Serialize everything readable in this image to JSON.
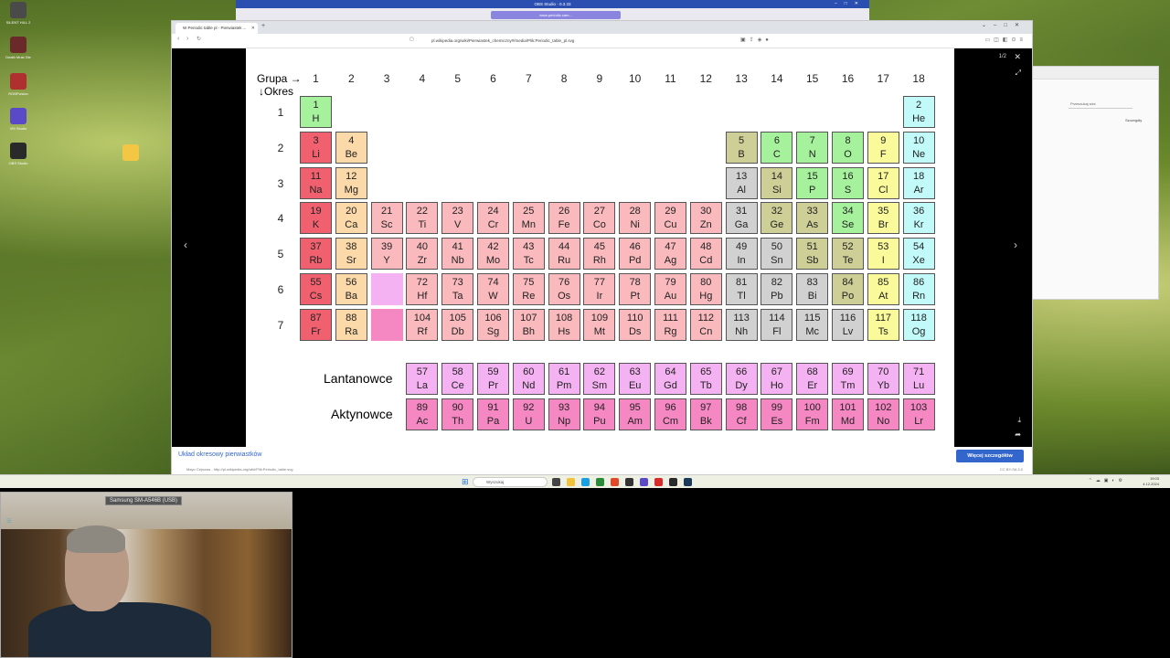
{
  "obs": {
    "title": "OBS Studio - 0.3.33",
    "active_tab": "www.periodic.cam..."
  },
  "browser": {
    "tab_title": "W Periodic table pl - Pierwiastek ...",
    "url": "pl.wikipedia.org/wiki/Pierwiastek_chemiczny#/media/Plik:Periodic_table_pl.svg",
    "viewer_counter": "1/2",
    "caption": "Układ okresowy pierwiastków",
    "author": "Mayo Cejnows - http://pl.wikipedia.org/wiki/Plik:Periodic_table.svg",
    "more_button": "Więcej szczegółów",
    "license": "CC BY-SA 3.0"
  },
  "right_window": {
    "field_placeholder": "Przeszukaj sieć",
    "button": "Szczegóły"
  },
  "desktop_icons": [
    {
      "label": "SILENT HILL 2",
      "color": "#4a4a4a"
    },
    {
      "label": "Death Must Die",
      "color": "#6a2a2a"
    },
    {
      "label": "ROBPvision",
      "color": "#b03030"
    },
    {
      "label": "VM Studio",
      "color": "#5a4ac8"
    },
    {
      "label": "OBS Studio",
      "color": "#2a2a2a"
    }
  ],
  "taskbar": {
    "search_placeholder": "Wyszukaj",
    "time": "19:03",
    "date": "4.12.2024"
  },
  "webcam": {
    "label": "Samsung SM-A546B (USB)"
  },
  "periodic_table": {
    "group_label": "Grupa →",
    "period_label": "↓Okres",
    "groups": [
      "1",
      "2",
      "3",
      "4",
      "5",
      "6",
      "7",
      "8",
      "9",
      "10",
      "11",
      "12",
      "13",
      "14",
      "15",
      "16",
      "17",
      "18"
    ],
    "periods": [
      "1",
      "2",
      "3",
      "4",
      "5",
      "6",
      "7"
    ],
    "lanthanides_label": "Lantanowce",
    "actinides_label": "Aktynowce",
    "elements": [
      {
        "n": "1",
        "s": "H",
        "g": 1,
        "p": 1,
        "c": "h"
      },
      {
        "n": "2",
        "s": "He",
        "g": 18,
        "p": 1,
        "c": "ng"
      },
      {
        "n": "3",
        "s": "Li",
        "g": 1,
        "p": 2,
        "c": "alk"
      },
      {
        "n": "4",
        "s": "Be",
        "g": 2,
        "p": 2,
        "c": "ae"
      },
      {
        "n": "5",
        "s": "B",
        "g": 13,
        "p": 2,
        "c": "met"
      },
      {
        "n": "6",
        "s": "C",
        "g": 14,
        "p": 2,
        "c": "nm"
      },
      {
        "n": "7",
        "s": "N",
        "g": 15,
        "p": 2,
        "c": "nm"
      },
      {
        "n": "8",
        "s": "O",
        "g": 16,
        "p": 2,
        "c": "nm"
      },
      {
        "n": "9",
        "s": "F",
        "g": 17,
        "p": 2,
        "c": "hal"
      },
      {
        "n": "10",
        "s": "Ne",
        "g": 18,
        "p": 2,
        "c": "ng"
      },
      {
        "n": "11",
        "s": "Na",
        "g": 1,
        "p": 3,
        "c": "alk"
      },
      {
        "n": "12",
        "s": "Mg",
        "g": 2,
        "p": 3,
        "c": "ae"
      },
      {
        "n": "13",
        "s": "Al",
        "g": 13,
        "p": 3,
        "c": "pm"
      },
      {
        "n": "14",
        "s": "Si",
        "g": 14,
        "p": 3,
        "c": "met"
      },
      {
        "n": "15",
        "s": "P",
        "g": 15,
        "p": 3,
        "c": "nm"
      },
      {
        "n": "16",
        "s": "S",
        "g": 16,
        "p": 3,
        "c": "nm"
      },
      {
        "n": "17",
        "s": "Cl",
        "g": 17,
        "p": 3,
        "c": "hal"
      },
      {
        "n": "18",
        "s": "Ar",
        "g": 18,
        "p": 3,
        "c": "ng"
      },
      {
        "n": "19",
        "s": "K",
        "g": 1,
        "p": 4,
        "c": "alk"
      },
      {
        "n": "20",
        "s": "Ca",
        "g": 2,
        "p": 4,
        "c": "ae"
      },
      {
        "n": "21",
        "s": "Sc",
        "g": 3,
        "p": 4,
        "c": "tm"
      },
      {
        "n": "22",
        "s": "Ti",
        "g": 4,
        "p": 4,
        "c": "tm"
      },
      {
        "n": "23",
        "s": "V",
        "g": 5,
        "p": 4,
        "c": "tm"
      },
      {
        "n": "24",
        "s": "Cr",
        "g": 6,
        "p": 4,
        "c": "tm"
      },
      {
        "n": "25",
        "s": "Mn",
        "g": 7,
        "p": 4,
        "c": "tm"
      },
      {
        "n": "26",
        "s": "Fe",
        "g": 8,
        "p": 4,
        "c": "tm"
      },
      {
        "n": "27",
        "s": "Co",
        "g": 9,
        "p": 4,
        "c": "tm"
      },
      {
        "n": "28",
        "s": "Ni",
        "g": 10,
        "p": 4,
        "c": "tm"
      },
      {
        "n": "29",
        "s": "Cu",
        "g": 11,
        "p": 4,
        "c": "tm"
      },
      {
        "n": "30",
        "s": "Zn",
        "g": 12,
        "p": 4,
        "c": "tm"
      },
      {
        "n": "31",
        "s": "Ga",
        "g": 13,
        "p": 4,
        "c": "pm"
      },
      {
        "n": "32",
        "s": "Ge",
        "g": 14,
        "p": 4,
        "c": "met"
      },
      {
        "n": "33",
        "s": "As",
        "g": 15,
        "p": 4,
        "c": "met"
      },
      {
        "n": "34",
        "s": "Se",
        "g": 16,
        "p": 4,
        "c": "nm"
      },
      {
        "n": "35",
        "s": "Br",
        "g": 17,
        "p": 4,
        "c": "hal"
      },
      {
        "n": "36",
        "s": "Kr",
        "g": 18,
        "p": 4,
        "c": "ng"
      },
      {
        "n": "37",
        "s": "Rb",
        "g": 1,
        "p": 5,
        "c": "alk"
      },
      {
        "n": "38",
        "s": "Sr",
        "g": 2,
        "p": 5,
        "c": "ae"
      },
      {
        "n": "39",
        "s": "Y",
        "g": 3,
        "p": 5,
        "c": "tm"
      },
      {
        "n": "40",
        "s": "Zr",
        "g": 4,
        "p": 5,
        "c": "tm"
      },
      {
        "n": "41",
        "s": "Nb",
        "g": 5,
        "p": 5,
        "c": "tm"
      },
      {
        "n": "42",
        "s": "Mo",
        "g": 6,
        "p": 5,
        "c": "tm"
      },
      {
        "n": "43",
        "s": "Tc",
        "g": 7,
        "p": 5,
        "c": "tm"
      },
      {
        "n": "44",
        "s": "Ru",
        "g": 8,
        "p": 5,
        "c": "tm"
      },
      {
        "n": "45",
        "s": "Rh",
        "g": 9,
        "p": 5,
        "c": "tm"
      },
      {
        "n": "46",
        "s": "Pd",
        "g": 10,
        "p": 5,
        "c": "tm"
      },
      {
        "n": "47",
        "s": "Ag",
        "g": 11,
        "p": 5,
        "c": "tm"
      },
      {
        "n": "48",
        "s": "Cd",
        "g": 12,
        "p": 5,
        "c": "tm"
      },
      {
        "n": "49",
        "s": "In",
        "g": 13,
        "p": 5,
        "c": "pm"
      },
      {
        "n": "50",
        "s": "Sn",
        "g": 14,
        "p": 5,
        "c": "pm"
      },
      {
        "n": "51",
        "s": "Sb",
        "g": 15,
        "p": 5,
        "c": "met"
      },
      {
        "n": "52",
        "s": "Te",
        "g": 16,
        "p": 5,
        "c": "met"
      },
      {
        "n": "53",
        "s": "I",
        "g": 17,
        "p": 5,
        "c": "hal"
      },
      {
        "n": "54",
        "s": "Xe",
        "g": 18,
        "p": 5,
        "c": "ng"
      },
      {
        "n": "55",
        "s": "Cs",
        "g": 1,
        "p": 6,
        "c": "alk"
      },
      {
        "n": "56",
        "s": "Ba",
        "g": 2,
        "p": 6,
        "c": "ae"
      },
      {
        "n": "",
        "s": "",
        "g": 3,
        "p": 6,
        "c": "lan"
      },
      {
        "n": "72",
        "s": "Hf",
        "g": 4,
        "p": 6,
        "c": "tm"
      },
      {
        "n": "73",
        "s": "Ta",
        "g": 5,
        "p": 6,
        "c": "tm"
      },
      {
        "n": "74",
        "s": "W",
        "g": 6,
        "p": 6,
        "c": "tm"
      },
      {
        "n": "75",
        "s": "Re",
        "g": 7,
        "p": 6,
        "c": "tm"
      },
      {
        "n": "76",
        "s": "Os",
        "g": 8,
        "p": 6,
        "c": "tm"
      },
      {
        "n": "77",
        "s": "Ir",
        "g": 9,
        "p": 6,
        "c": "tm"
      },
      {
        "n": "78",
        "s": "Pt",
        "g": 10,
        "p": 6,
        "c": "tm"
      },
      {
        "n": "79",
        "s": "Au",
        "g": 11,
        "p": 6,
        "c": "tm"
      },
      {
        "n": "80",
        "s": "Hg",
        "g": 12,
        "p": 6,
        "c": "tm"
      },
      {
        "n": "81",
        "s": "Tl",
        "g": 13,
        "p": 6,
        "c": "pm"
      },
      {
        "n": "82",
        "s": "Pb",
        "g": 14,
        "p": 6,
        "c": "pm"
      },
      {
        "n": "83",
        "s": "Bi",
        "g": 15,
        "p": 6,
        "c": "pm"
      },
      {
        "n": "84",
        "s": "Po",
        "g": 16,
        "p": 6,
        "c": "met"
      },
      {
        "n": "85",
        "s": "At",
        "g": 17,
        "p": 6,
        "c": "hal"
      },
      {
        "n": "86",
        "s": "Rn",
        "g": 18,
        "p": 6,
        "c": "ng"
      },
      {
        "n": "87",
        "s": "Fr",
        "g": 1,
        "p": 7,
        "c": "alk"
      },
      {
        "n": "88",
        "s": "Ra",
        "g": 2,
        "p": 7,
        "c": "ae"
      },
      {
        "n": "",
        "s": "",
        "g": 3,
        "p": 7,
        "c": "act"
      },
      {
        "n": "104",
        "s": "Rf",
        "g": 4,
        "p": 7,
        "c": "tm"
      },
      {
        "n": "105",
        "s": "Db",
        "g": 5,
        "p": 7,
        "c": "tm"
      },
      {
        "n": "106",
        "s": "Sg",
        "g": 6,
        "p": 7,
        "c": "tm"
      },
      {
        "n": "107",
        "s": "Bh",
        "g": 7,
        "p": 7,
        "c": "tm"
      },
      {
        "n": "108",
        "s": "Hs",
        "g": 8,
        "p": 7,
        "c": "tm"
      },
      {
        "n": "109",
        "s": "Mt",
        "g": 9,
        "p": 7,
        "c": "tm"
      },
      {
        "n": "110",
        "s": "Ds",
        "g": 10,
        "p": 7,
        "c": "tm"
      },
      {
        "n": "111",
        "s": "Rg",
        "g": 11,
        "p": 7,
        "c": "tm"
      },
      {
        "n": "112",
        "s": "Cn",
        "g": 12,
        "p": 7,
        "c": "tm"
      },
      {
        "n": "113",
        "s": "Nh",
        "g": 13,
        "p": 7,
        "c": "pm"
      },
      {
        "n": "114",
        "s": "Fl",
        "g": 14,
        "p": 7,
        "c": "pm"
      },
      {
        "n": "115",
        "s": "Mc",
        "g": 15,
        "p": 7,
        "c": "pm"
      },
      {
        "n": "116",
        "s": "Lv",
        "g": 16,
        "p": 7,
        "c": "pm"
      },
      {
        "n": "117",
        "s": "Ts",
        "g": 17,
        "p": 7,
        "c": "hal"
      },
      {
        "n": "118",
        "s": "Og",
        "g": 18,
        "p": 7,
        "c": "ng"
      }
    ],
    "lanthanides": [
      {
        "n": "57",
        "s": "La"
      },
      {
        "n": "58",
        "s": "Ce"
      },
      {
        "n": "59",
        "s": "Pr"
      },
      {
        "n": "60",
        "s": "Nd"
      },
      {
        "n": "61",
        "s": "Pm"
      },
      {
        "n": "62",
        "s": "Sm"
      },
      {
        "n": "63",
        "s": "Eu"
      },
      {
        "n": "64",
        "s": "Gd"
      },
      {
        "n": "65",
        "s": "Tb"
      },
      {
        "n": "66",
        "s": "Dy"
      },
      {
        "n": "67",
        "s": "Ho"
      },
      {
        "n": "68",
        "s": "Er"
      },
      {
        "n": "69",
        "s": "Tm"
      },
      {
        "n": "70",
        "s": "Yb"
      },
      {
        "n": "71",
        "s": "Lu"
      }
    ],
    "actinides": [
      {
        "n": "89",
        "s": "Ac"
      },
      {
        "n": "90",
        "s": "Th"
      },
      {
        "n": "91",
        "s": "Pa"
      },
      {
        "n": "92",
        "s": "U"
      },
      {
        "n": "93",
        "s": "Np"
      },
      {
        "n": "94",
        "s": "Pu"
      },
      {
        "n": "95",
        "s": "Am"
      },
      {
        "n": "96",
        "s": "Cm"
      },
      {
        "n": "97",
        "s": "Bk"
      },
      {
        "n": "98",
        "s": "Cf"
      },
      {
        "n": "99",
        "s": "Es"
      },
      {
        "n": "100",
        "s": "Fm"
      },
      {
        "n": "101",
        "s": "Md"
      },
      {
        "n": "102",
        "s": "No"
      },
      {
        "n": "103",
        "s": "Lr"
      }
    ]
  }
}
